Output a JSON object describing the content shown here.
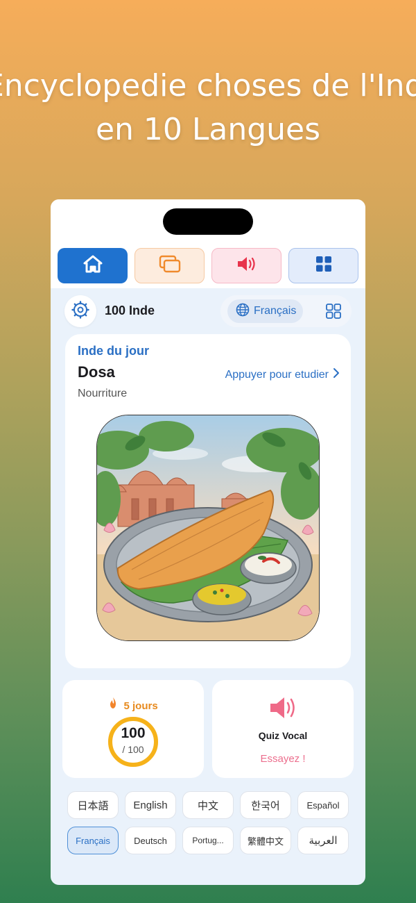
{
  "headline": {
    "line1": "Encyclopedie choses de l'Inde",
    "line2": "en 10 Langues"
  },
  "tabs": [
    {
      "name": "home",
      "icon": "home-icon"
    },
    {
      "name": "cards",
      "icon": "cards-icon"
    },
    {
      "name": "audio",
      "icon": "speaker-icon"
    },
    {
      "name": "grid",
      "icon": "grid-icon"
    }
  ],
  "header": {
    "app_name": "100 Inde",
    "language": "Français"
  },
  "daily": {
    "kicker": "Inde du jour",
    "title": "Dosa",
    "category": "Nourriture",
    "study_link": "Appuyer pour etudier"
  },
  "progress": {
    "streak": "5 jours",
    "learned": "100",
    "total": "/ 100",
    "fraction": 1.0
  },
  "quiz": {
    "title": "Quiz Vocal",
    "cta": "Essayez !"
  },
  "languages": [
    {
      "label": "日本語",
      "selected": false
    },
    {
      "label": "English",
      "selected": false
    },
    {
      "label": "中文",
      "selected": false
    },
    {
      "label": "한국어",
      "selected": false
    },
    {
      "label": "Español",
      "selected": false
    },
    {
      "label": "Français",
      "selected": true
    },
    {
      "label": "Deutsch",
      "selected": false
    },
    {
      "label": "Portug...",
      "selected": false
    },
    {
      "label": "繁體中文",
      "selected": false
    },
    {
      "label": "العربية",
      "selected": false
    }
  ],
  "colors": {
    "accent": "#1f72cf",
    "streak": "#e78a1e",
    "quiz": "#ec6e8d",
    "ring": "#f6b21a"
  }
}
